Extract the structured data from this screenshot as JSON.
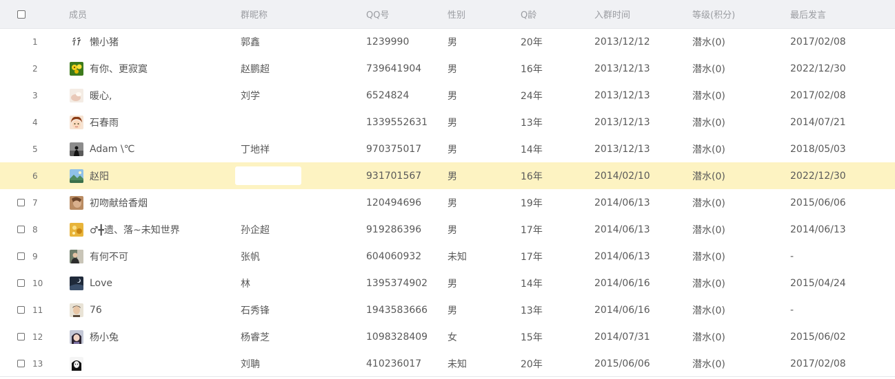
{
  "header": {
    "member": "成员",
    "nickname": "群昵称",
    "qq": "QQ号",
    "gender": "性别",
    "q_age": "Q龄",
    "join_time": "入群时间",
    "level": "等级(积分)",
    "last_speak": "最后发言"
  },
  "rows": [
    {
      "index": "1",
      "name": "懒小猪",
      "nickname": "郭鑫",
      "qq": "1239990",
      "gender": "男",
      "q_age": "20年",
      "join": "2013/12/12",
      "level": "潜水(0)",
      "last": "2017/02/08",
      "avatar": "kanji-avatar-icon"
    },
    {
      "index": "2",
      "name": "有你、更寂寞",
      "nickname": "赵鹏超",
      "qq": "739641904",
      "gender": "男",
      "q_age": "16年",
      "join": "2013/12/13",
      "level": "潜水(0)",
      "last": "2022/12/30",
      "avatar": "flower-avatar-icon"
    },
    {
      "index": "3",
      "name": "暖心,",
      "nickname": "刘学",
      "qq": "6524824",
      "gender": "男",
      "q_age": "24年",
      "join": "2013/12/13",
      "level": "潜水(0)",
      "last": "2017/02/08",
      "avatar": "pale-avatar-icon"
    },
    {
      "index": "4",
      "name": "石春雨",
      "nickname": "",
      "qq": "1339552631",
      "gender": "男",
      "q_age": "13年",
      "join": "2013/12/13",
      "level": "潜水(0)",
      "last": "2014/07/21",
      "avatar": "anime-avatar-icon"
    },
    {
      "index": "5",
      "name": "Adam \\℃",
      "nickname": "丁地祥",
      "qq": "970375017",
      "gender": "男",
      "q_age": "14年",
      "join": "2013/12/13",
      "level": "潜水(0)",
      "last": "2018/05/03",
      "avatar": "silhouette-avatar-icon"
    },
    {
      "index": "6",
      "name": "赵阳",
      "nickname": "",
      "qq": "931701567",
      "gender": "男",
      "q_age": "16年",
      "join": "2014/02/10",
      "level": "潜水(0)",
      "last": "2022/12/30",
      "avatar": "landscape-avatar-icon"
    },
    {
      "index": "7",
      "name": "初吻献给香烟",
      "nickname": "",
      "qq": "120494696",
      "gender": "男",
      "q_age": "19年",
      "join": "2014/06/13",
      "level": "潜水(0)",
      "last": "2015/06/06",
      "avatar": "brown-avatar-icon"
    },
    {
      "index": "8",
      "name": "♂╋遗、落~未知世界",
      "nickname": "孙企超",
      "qq": "919286396",
      "gender": "男",
      "q_age": "17年",
      "join": "2014/06/13",
      "level": "潜水(0)",
      "last": "2014/06/13",
      "avatar": "golden-avatar-icon"
    },
    {
      "index": "9",
      "name": "有何不可",
      "nickname": "张帆",
      "qq": "604060932",
      "gender": "未知",
      "q_age": "17年",
      "join": "2014/06/13",
      "level": "潜水(0)",
      "last": "-",
      "avatar": "person-avatar-icon"
    },
    {
      "index": "10",
      "name": "Love",
      "nickname": "林",
      "qq": "1395374902",
      "gender": "男",
      "q_age": "14年",
      "join": "2014/06/16",
      "level": "潜水(0)",
      "last": "2015/04/24",
      "avatar": "night-avatar-icon"
    },
    {
      "index": "11",
      "name": "76",
      "nickname": "石秀锋",
      "qq": "1943583666",
      "gender": "男",
      "q_age": "13年",
      "join": "2014/06/16",
      "level": "潜水(0)",
      "last": "-",
      "avatar": "portrait-avatar-icon"
    },
    {
      "index": "12",
      "name": "杨小兔",
      "nickname": "杨睿芝",
      "qq": "1098328409",
      "gender": "女",
      "q_age": "15年",
      "join": "2014/07/31",
      "level": "潜水(0)",
      "last": "2015/06/02",
      "avatar": "girl-avatar-icon"
    },
    {
      "index": "13",
      "name": "",
      "nickname": "刘聃",
      "qq": "410236017",
      "gender": "未知",
      "q_age": "20年",
      "join": "2015/06/06",
      "level": "潜水(0)",
      "last": "2017/02/08",
      "avatar": "bw-avatar-icon"
    }
  ],
  "colors": {
    "header_bg": "#f0f1f4",
    "highlight_row": "#fdf3c2",
    "text": "#595959"
  }
}
